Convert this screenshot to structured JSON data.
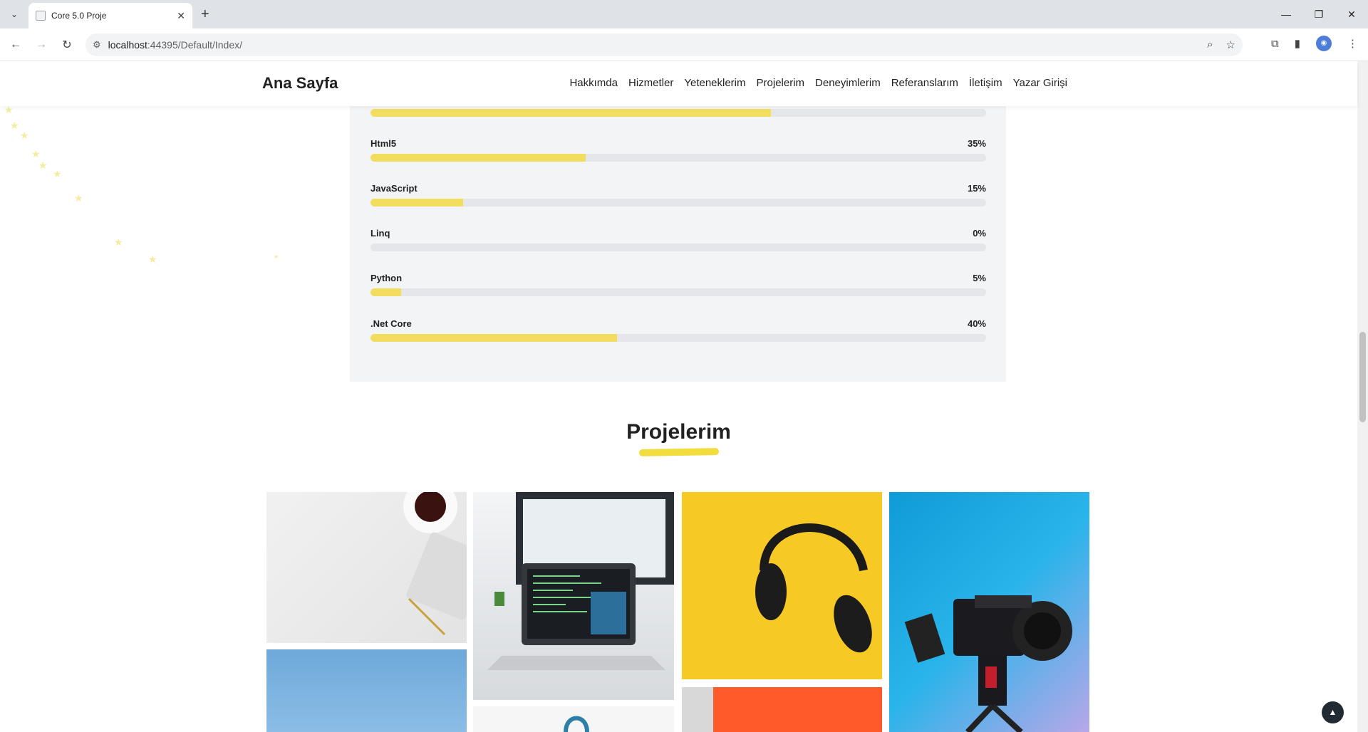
{
  "browser": {
    "tab_title": "Core 5.0 Proje",
    "url_host": "localhost",
    "url_rest": ":44395/Default/Index/"
  },
  "site": {
    "brand": "Ana Sayfa",
    "nav": [
      "Hakkımda",
      "Hizmetler",
      "Yeteneklerim",
      "Projelerim",
      "Deneyimlerim",
      "Referanslarım",
      "İletişim",
      "Yazar Girişi"
    ]
  },
  "skills": [
    {
      "name": "",
      "percent": "",
      "level": 0.65
    },
    {
      "name": "Html5",
      "percent": "35%",
      "level": 0.35
    },
    {
      "name": "JavaScript",
      "percent": "15%",
      "level": 0.15
    },
    {
      "name": "Linq",
      "percent": "0%",
      "level": 0.0
    },
    {
      "name": "Python",
      "percent": "5%",
      "level": 0.05
    },
    {
      "name": ".Net Core",
      "percent": "40%",
      "level": 0.4
    }
  ],
  "projects": {
    "title": "Projelerim",
    "tiles": [
      "keyboard-and-coffee",
      "laptop-code",
      "yellow-headphones",
      "camera-rig",
      "blue-sky",
      "cable-item",
      "orange-notebook"
    ]
  },
  "icons": [
    "tab-down-icon",
    "favicon-icon",
    "close-icon",
    "new-tab-icon",
    "back-icon",
    "forward-icon",
    "reload-icon",
    "site-info-icon",
    "zoom-icon",
    "star-icon",
    "extensions-icon",
    "sidebar-icon",
    "profile-icon",
    "menu-icon",
    "back-to-top-icon"
  ],
  "colors": {
    "accent": "#f2dd5e",
    "track": "#e4e6e9",
    "panel": "#f3f4f6"
  }
}
